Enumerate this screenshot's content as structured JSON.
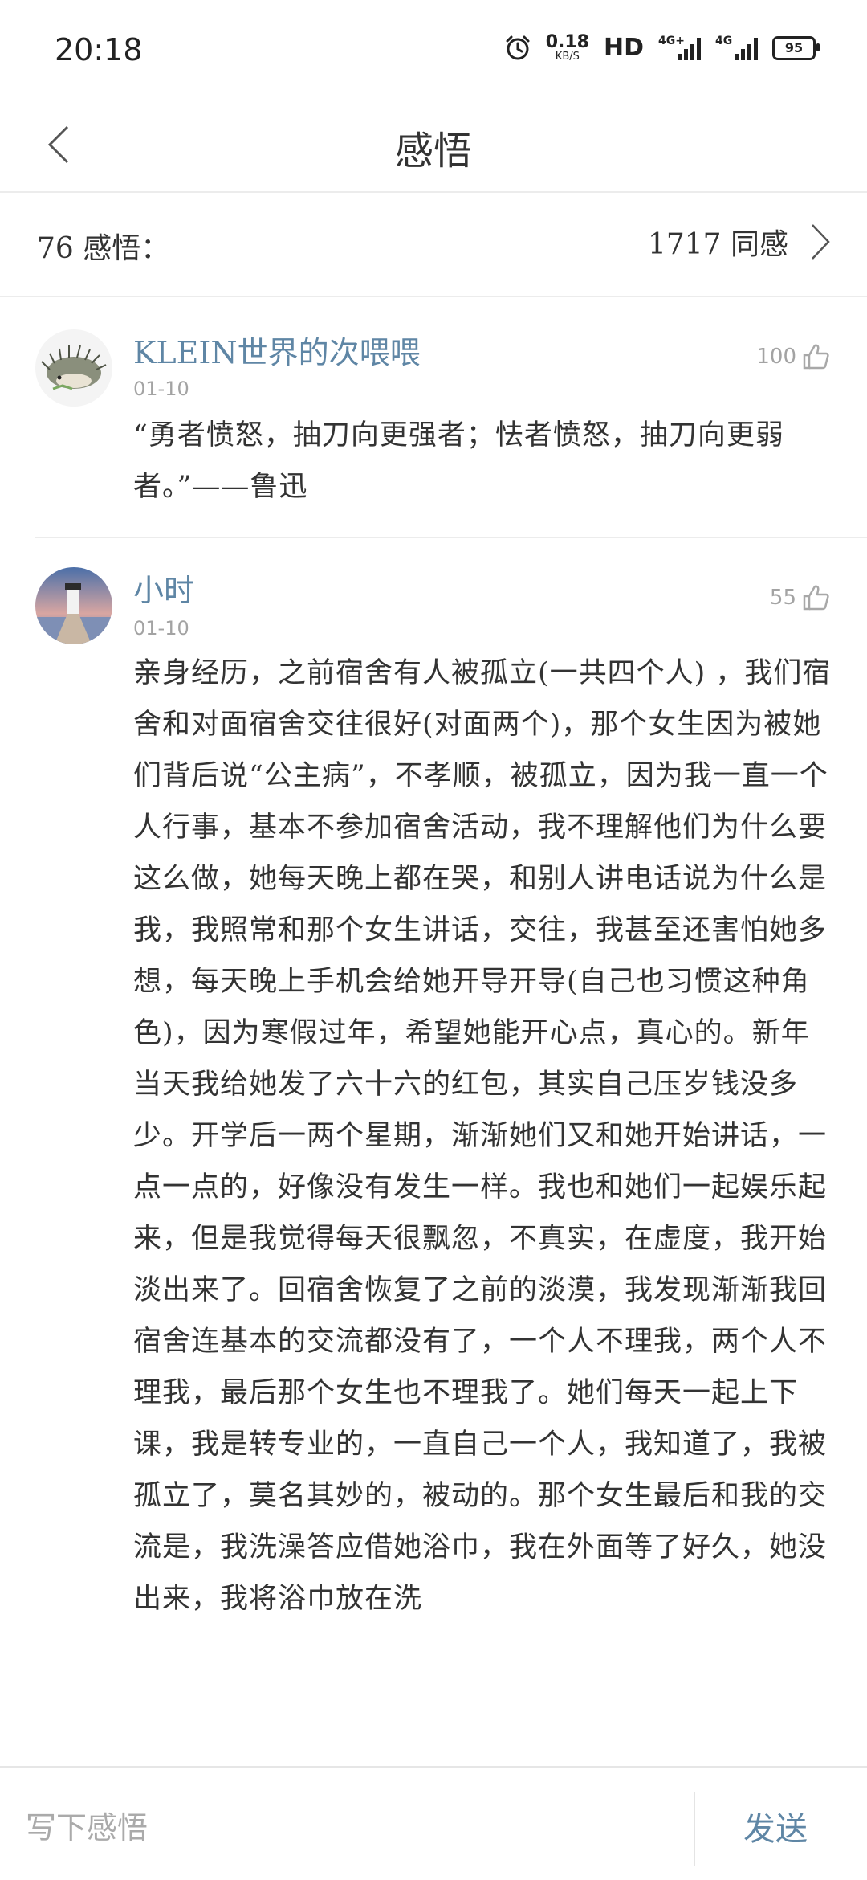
{
  "status_bar": {
    "time": "20:18",
    "net_speed_value": "0.18",
    "net_speed_unit": "KB/S",
    "hd_label": "HD",
    "signal1_label": "4G+",
    "signal2_label": "4G",
    "battery": "95"
  },
  "header": {
    "title": "感悟"
  },
  "stats": {
    "count_label": "76 感悟：",
    "agree_label": "1717 同感"
  },
  "comments": [
    {
      "user": "KLEIN世界的次喂喂",
      "date": "01-10",
      "likes": "100",
      "text": "“勇者愤怒，抽刀向更强者；怯者愤怒，抽刀向更弱者。”——鲁迅"
    },
    {
      "user": "小时",
      "date": "01-10",
      "likes": "55",
      "text": "亲身经历，之前宿舍有人被孤立(一共四个人) ，我们宿舍和对面宿舍交往很好(对面两个)，那个女生因为被她们背后说“公主病”，不孝顺，被孤立，因为我一直一个人行事，基本不参加宿舍活动，我不理解他们为什么要这么做，她每天晚上都在哭，和别人讲电话说为什么是我，我照常和那个女生讲话，交往，我甚至还害怕她多想，每天晚上手机会给她开导开导(自己也习惯这种角色)，因为寒假过年，希望她能开心点，真心的。新年当天我给她发了六十六的红包，其实自己压岁钱没多少。开学后一两个星期，渐渐她们又和她开始讲话，一点一点的，好像没有发生一样。我也和她们一起娱乐起来，但是我觉得每天很飘忽，不真实，在虚度，我开始淡出来了。回宿舍恢复了之前的淡漠，我发现渐渐我回宿舍连基本的交流都没有了，一个人不理我，两个人不理我，最后那个女生也不理我了。她们每天一起上下课，我是转专业的，一直自己一个人，我知道了，我被孤立了，莫名其妙的，被动的。那个女生最后和我的交流是，我洗澡答应借她浴巾，我在外面等了好久，她没出来，我将浴巾放在洗"
    }
  ],
  "composer": {
    "placeholder": "写下感悟",
    "send_label": "发送"
  },
  "colors": {
    "accent": "#5f86a5",
    "muted": "#a3a3a3",
    "divider": "#ececec"
  }
}
